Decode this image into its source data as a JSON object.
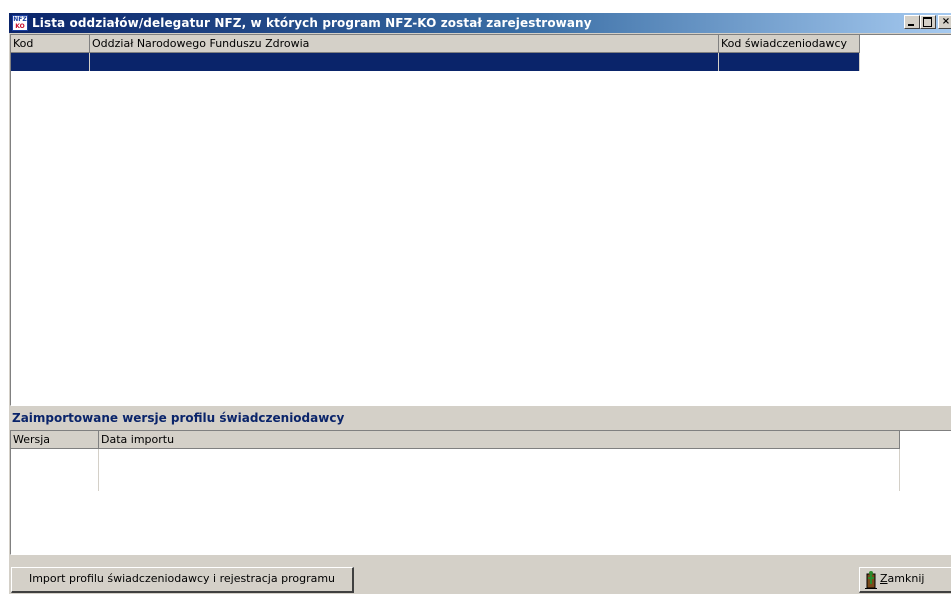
{
  "window": {
    "icon_text_line1": "NFZ",
    "icon_text_line2": "KO",
    "title": "Lista oddziałów/delegatur NFZ, w których program NFZ-KO został zarejestrowany",
    "controls": {
      "minimize": "_",
      "maximize": "□",
      "close": "×"
    }
  },
  "branches_table": {
    "columns": [
      "Kod",
      "Oddział Narodowego Funduszu Zdrowia",
      "Kod świadczeniodawcy"
    ],
    "rows": [
      {
        "kod": "",
        "oddzial": "",
        "kod_swiadczeniodawcy": "",
        "selected": true
      }
    ]
  },
  "versions_section": {
    "title": "Zaimportowane wersje profilu świadczeniodawcy",
    "columns": [
      "Wersja",
      "Data importu"
    ],
    "rows": []
  },
  "buttons": {
    "import": "Import profilu świadczeniodawcy i rejestracja programu",
    "close_mnemonic": "Z",
    "close_rest": "amknij"
  },
  "colors": {
    "title_bar_start": "#0a246a",
    "title_bar_end": "#a6caf0",
    "selection": "#0a246a",
    "section_title": "#0a246a",
    "face": "#d4d0c8"
  }
}
